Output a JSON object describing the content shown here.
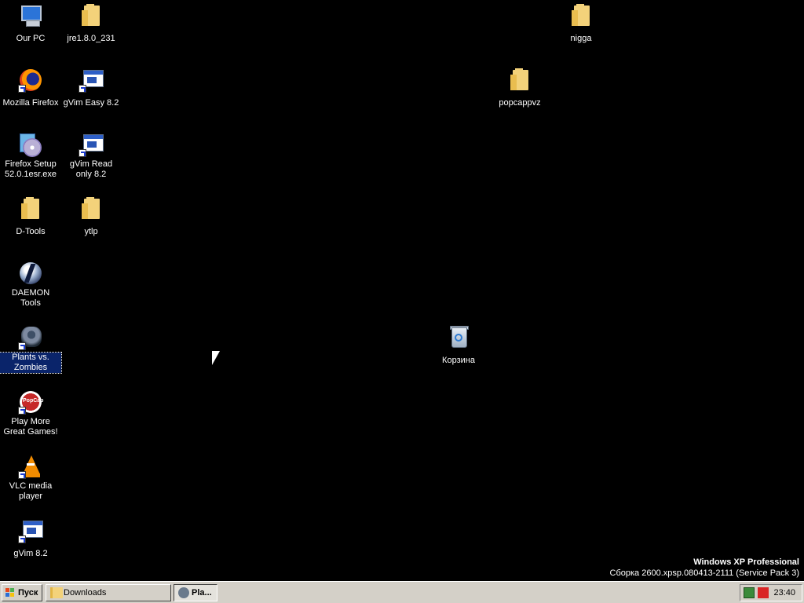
{
  "desktop": {
    "icons": [
      {
        "label": "Our PC",
        "icon": "computer-icon"
      },
      {
        "label": "jre1.8.0_231",
        "icon": "folder-icon"
      },
      {
        "label": "nigga",
        "icon": "folder-icon"
      },
      {
        "label": "Mozilla Firefox",
        "icon": "firefox-icon"
      },
      {
        "label": "gVim Easy 8.2",
        "icon": "gvim-icon"
      },
      {
        "label": "popcappvz",
        "icon": "folder-icon"
      },
      {
        "label": "Firefox Setup 52.0.1esr.exe",
        "icon": "installer-icon"
      },
      {
        "label": "gVim Read only 8.2",
        "icon": "gvim-icon"
      },
      {
        "label": "D-Tools",
        "icon": "folder-icon"
      },
      {
        "label": "ytlp",
        "icon": "folder-icon"
      },
      {
        "label": "DAEMON Tools",
        "icon": "daemon-tools-icon"
      },
      {
        "label": "Plants vs. Zombies",
        "icon": "plants-vs-zombies-icon",
        "selected": true
      },
      {
        "label": "Корзина",
        "icon": "recycle-bin-icon"
      },
      {
        "label": "Play More Great Games!",
        "icon": "popcap-icon"
      },
      {
        "label": "VLC media player",
        "icon": "vlc-icon"
      },
      {
        "label": "gVim 8.2",
        "icon": "gvim-icon"
      }
    ],
    "popcap_logo_text": "PopCap"
  },
  "watermark": {
    "line1": "Windows XP Professional",
    "line2": "Сборка 2600.xpsp.080413-2111 (Service Pack 3)"
  },
  "taskbar": {
    "start_label": "Пуск",
    "tasks": [
      {
        "label": "Downloads",
        "icon": "folder-icon"
      },
      {
        "label": "Pla...",
        "icon": "plants-vs-zombies-icon",
        "active": true
      }
    ],
    "tray": {
      "icons": [
        "network-icon",
        "antivirus-icon"
      ],
      "clock": "23:40"
    }
  },
  "colors": {
    "desktop_background": "#000000",
    "selection": "#0a246a",
    "taskbar": "#d4d0c8"
  }
}
